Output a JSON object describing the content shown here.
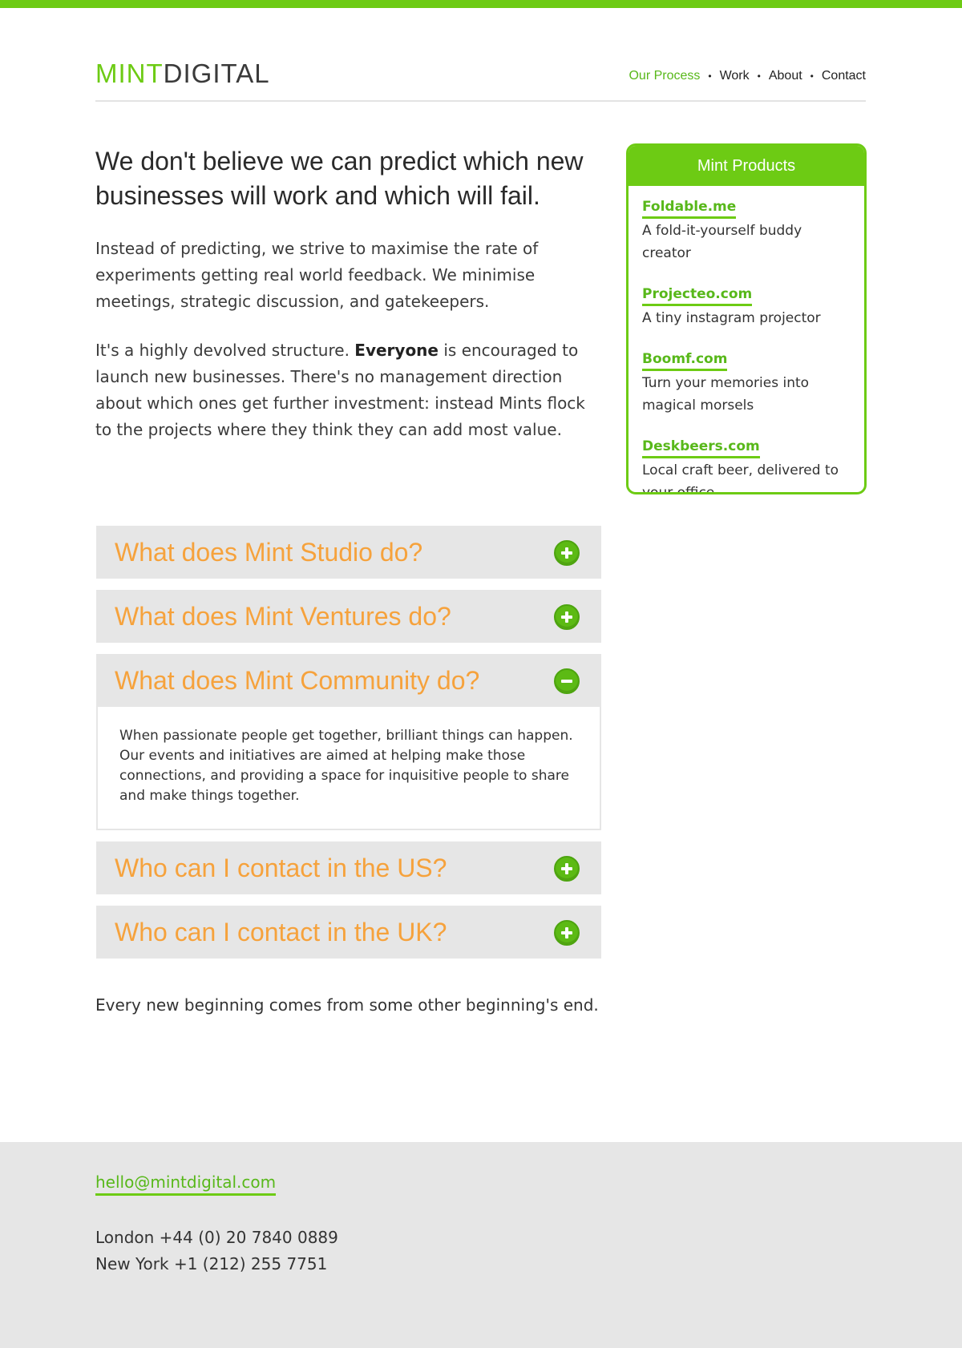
{
  "brand": {
    "logo_mint": "MINT",
    "logo_digital": "DIGITAL",
    "accent_color": "#6dcb14",
    "heading_color": "#f6a23c"
  },
  "nav": {
    "items": [
      {
        "label": "Our Process",
        "active": true
      },
      {
        "label": "Work",
        "active": false
      },
      {
        "label": "About",
        "active": false
      },
      {
        "label": "Contact",
        "active": false
      }
    ],
    "separator": "•"
  },
  "main": {
    "headline": "We don't believe we can predict which new businesses will work and which will fail.",
    "para1": "Instead of predicting, we strive to maximise the rate of experiments getting real world feedback. We minimise meetings, strategic discussion, and gatekeepers.",
    "para2_before": "It's a highly devolved structure. ",
    "para2_bold": "Everyone",
    "para2_after": " is encouraged to launch new businesses. There's no management direction about which ones get further investment: instead Mints flock to the projects where they think they can add most value."
  },
  "accordion": [
    {
      "title": "What does Mint Studio do?",
      "expanded": false,
      "icon": "plus-icon"
    },
    {
      "title": "What does Mint Ventures do?",
      "expanded": false,
      "icon": "plus-icon"
    },
    {
      "title": "What does Mint Community do?",
      "expanded": true,
      "icon": "minus-icon",
      "body": "When passionate people get together, brilliant things can happen. Our events and initiatives are aimed at helping make those connections, and providing a space for inquisitive people to share and make things together."
    },
    {
      "title": "Who can I contact in the US?",
      "expanded": false,
      "icon": "plus-icon"
    },
    {
      "title": "Who can I contact in the UK?",
      "expanded": false,
      "icon": "plus-icon"
    }
  ],
  "closing": "Every new beginning comes from some other beginning's end.",
  "sidebar": {
    "title": "Mint Products",
    "products": [
      {
        "name": "Foldable.me",
        "desc": "A fold-it-yourself buddy creator"
      },
      {
        "name": "Projecteo.com",
        "desc": "A tiny instagram projector"
      },
      {
        "name": "Boomf.com",
        "desc": "Turn your memories into magical morsels"
      },
      {
        "name": "Deskbeers.com",
        "desc": "Local craft beer, delivered to your office"
      }
    ]
  },
  "footer": {
    "email": "hello@mintdigital.com",
    "london": "London +44 (0) 20 7840 0889",
    "newyork": "New York +1 (212) 255 7751"
  }
}
